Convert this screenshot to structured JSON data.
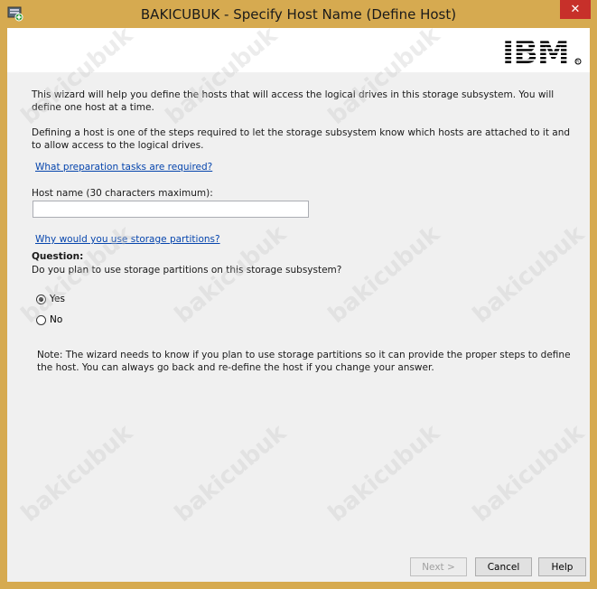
{
  "window": {
    "title": "BAKICUBUK - Specify Host Name (Define Host)",
    "close_symbol": "✕"
  },
  "banner": {
    "logo_text": "IBM"
  },
  "intro": {
    "paragraph1": "This wizard will help you define the hosts that will access the logical drives in this storage subsystem.  You will define one host at a time.",
    "paragraph2": "Defining a host is one of the steps required to let the storage subsystem know which hosts are attached to it and to allow access to the logical drives."
  },
  "links": {
    "preparation": "What preparation tasks are required?",
    "partitions": "Why would you use storage partitions?"
  },
  "host_name": {
    "label": "Host name (30 characters maximum):",
    "value": ""
  },
  "question": {
    "heading": "Question:",
    "text": "Do you plan to use storage partitions on this storage subsystem?",
    "options": [
      {
        "label": "Yes",
        "selected": true
      },
      {
        "label": "No",
        "selected": false
      }
    ]
  },
  "note": "Note: The wizard needs to know if you plan to use storage partitions so it can provide the proper steps to define the host. You can always go back and re-define the host if you change your answer.",
  "buttons": {
    "next": "Next >",
    "cancel": "Cancel",
    "help": "Help"
  },
  "watermark": "bakicubuk",
  "colors": {
    "titlebar": "#d6aa50",
    "close": "#c7302a",
    "link": "#0645ad"
  }
}
